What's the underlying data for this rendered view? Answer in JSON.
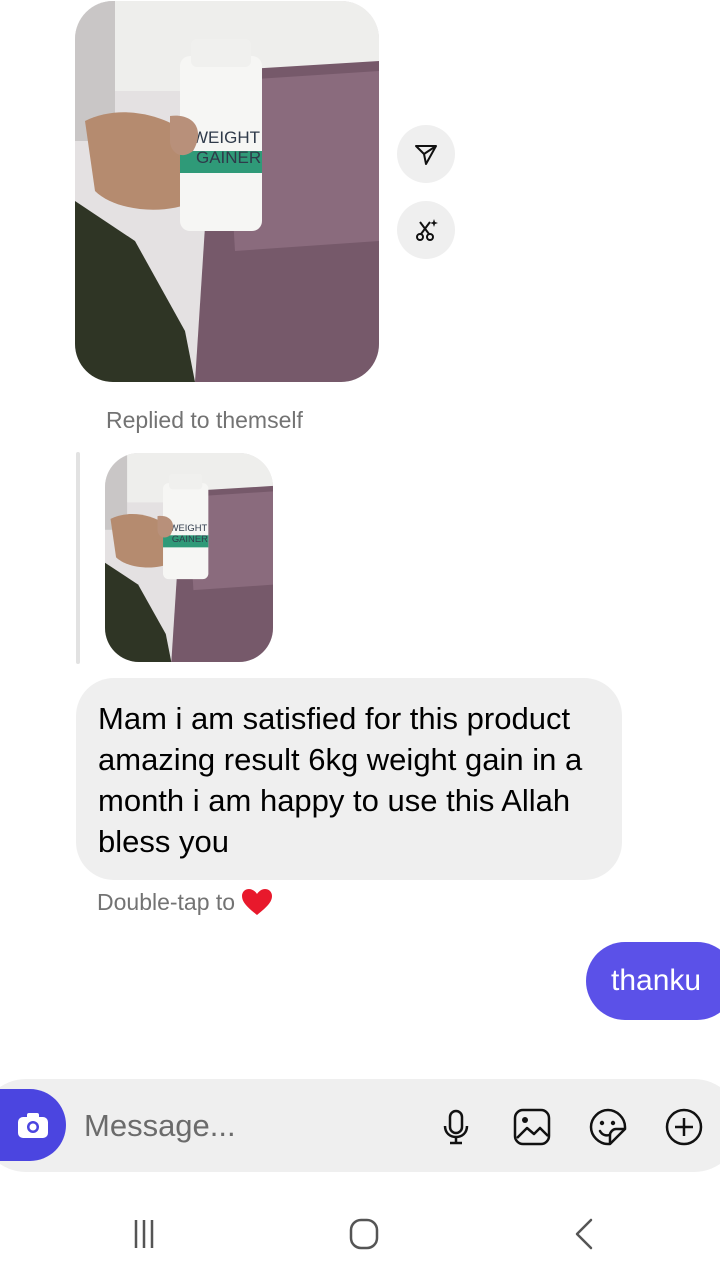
{
  "thread": {
    "photo_label_line1": "WEIGHT",
    "photo_label_line2": "GAINER",
    "reply_label": "Replied to themself",
    "received_message": "Mam i am satisfied for this product amazing result 6kg weight gain in a month i am happy to use this Allah bless you",
    "double_tap_hint": "Double-tap to",
    "sent_message": "thanku"
  },
  "composer": {
    "placeholder": "Message..."
  },
  "icons": {
    "share": "paper-plane-icon",
    "ai_edit": "scissors-sparkle-icon",
    "heart": "heart-icon",
    "camera": "camera-icon",
    "mic": "microphone-icon",
    "gallery": "image-icon",
    "sticker": "sticker-icon",
    "add": "plus-circle-icon",
    "nav_recents": "recents-icon",
    "nav_home": "home-icon",
    "nav_back": "back-icon"
  },
  "colors": {
    "sent_bubble": "#5b51e8",
    "received_bubble": "#efefef",
    "camera_button": "#4b45e0",
    "heart": "#e8192c"
  }
}
